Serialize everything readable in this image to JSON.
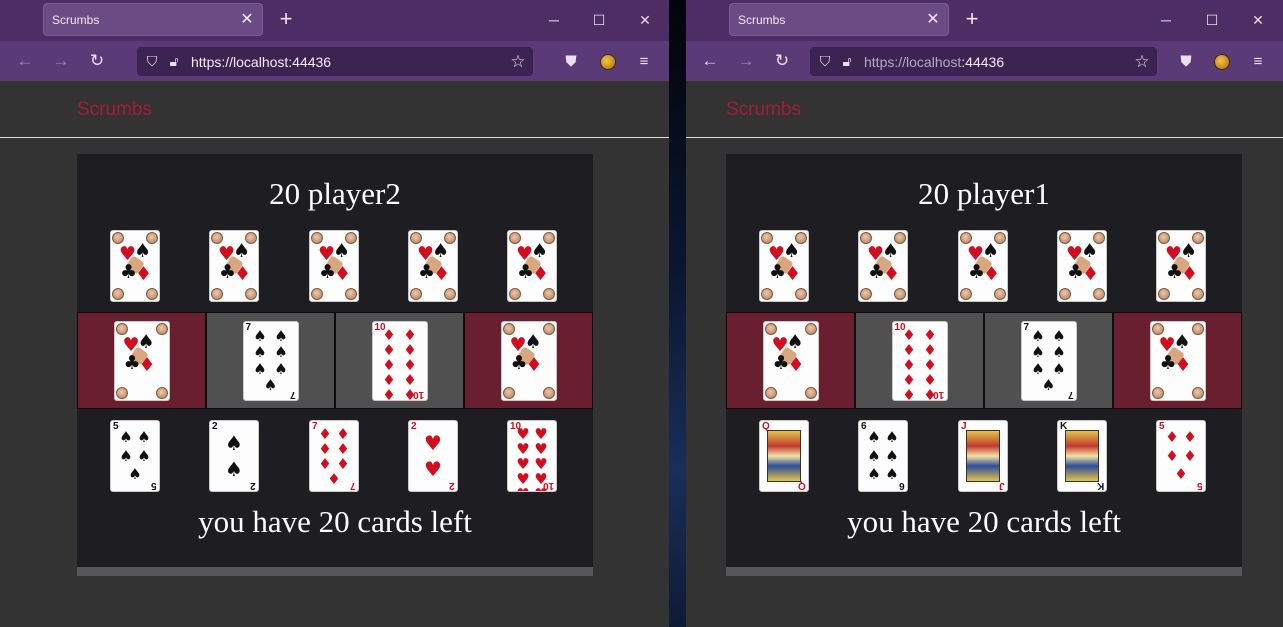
{
  "windows": [
    {
      "tab_title": "Scrumbs",
      "url": "https://localhost:44436",
      "url_host": "https://localhost",
      "url_port": ":44436",
      "brand": "Scrumbs",
      "board_title": "20 player2",
      "status": "you have 20 cards left",
      "opponent_cards": 5,
      "play_area": [
        {
          "cell": "maroon",
          "card": "back"
        },
        {
          "cell": "grey",
          "card": {
            "rank": "7",
            "suit": "♠",
            "color": "black"
          }
        },
        {
          "cell": "grey",
          "card": {
            "rank": "10",
            "suit": "♦",
            "color": "red"
          }
        },
        {
          "cell": "maroon",
          "card": "back"
        }
      ],
      "hand": [
        {
          "rank": "5",
          "suit": "♠",
          "color": "black"
        },
        {
          "rank": "2",
          "suit": "♠",
          "color": "black"
        },
        {
          "rank": "7",
          "suit": "♦",
          "color": "red"
        },
        {
          "rank": "2",
          "suit": "♥",
          "color": "red"
        },
        {
          "rank": "10",
          "suit": "♥",
          "color": "red"
        }
      ]
    },
    {
      "tab_title": "Scrumbs",
      "url": "https://localhost:44436",
      "url_host": "https://localhost",
      "url_port": ":44436",
      "brand": "Scrumbs",
      "board_title": "20 player1",
      "status": "you have 20 cards left",
      "opponent_cards": 5,
      "play_area": [
        {
          "cell": "maroon",
          "card": "back"
        },
        {
          "cell": "grey",
          "card": {
            "rank": "10",
            "suit": "♦",
            "color": "red"
          }
        },
        {
          "cell": "grey",
          "card": {
            "rank": "7",
            "suit": "♠",
            "color": "black"
          }
        },
        {
          "cell": "maroon",
          "card": "back"
        }
      ],
      "hand": [
        {
          "rank": "Q",
          "suit": "♥",
          "color": "red"
        },
        {
          "rank": "6",
          "suit": "♠",
          "color": "black"
        },
        {
          "rank": "J",
          "suit": "♥",
          "color": "red"
        },
        {
          "rank": "K",
          "suit": "♣",
          "color": "black"
        },
        {
          "rank": "5",
          "suit": "♦",
          "color": "red"
        }
      ]
    }
  ],
  "icons": {
    "back": "back-arrow-icon",
    "forward": "forward-arrow-icon",
    "reload": "reload-icon",
    "shield": "shield-icon",
    "lock": "lock-icon",
    "bookmark": "star-icon",
    "pocket": "pocket-icon",
    "extension": "extension-icon",
    "menu": "hamburger-menu-icon"
  },
  "colors": {
    "tabbar": "#4d2d63",
    "navbar": "#5b3a78",
    "brand": "#a31c3c",
    "maroon_cell": "#6a1f30",
    "grey_cell": "#505050",
    "board": "#1e1e22"
  }
}
